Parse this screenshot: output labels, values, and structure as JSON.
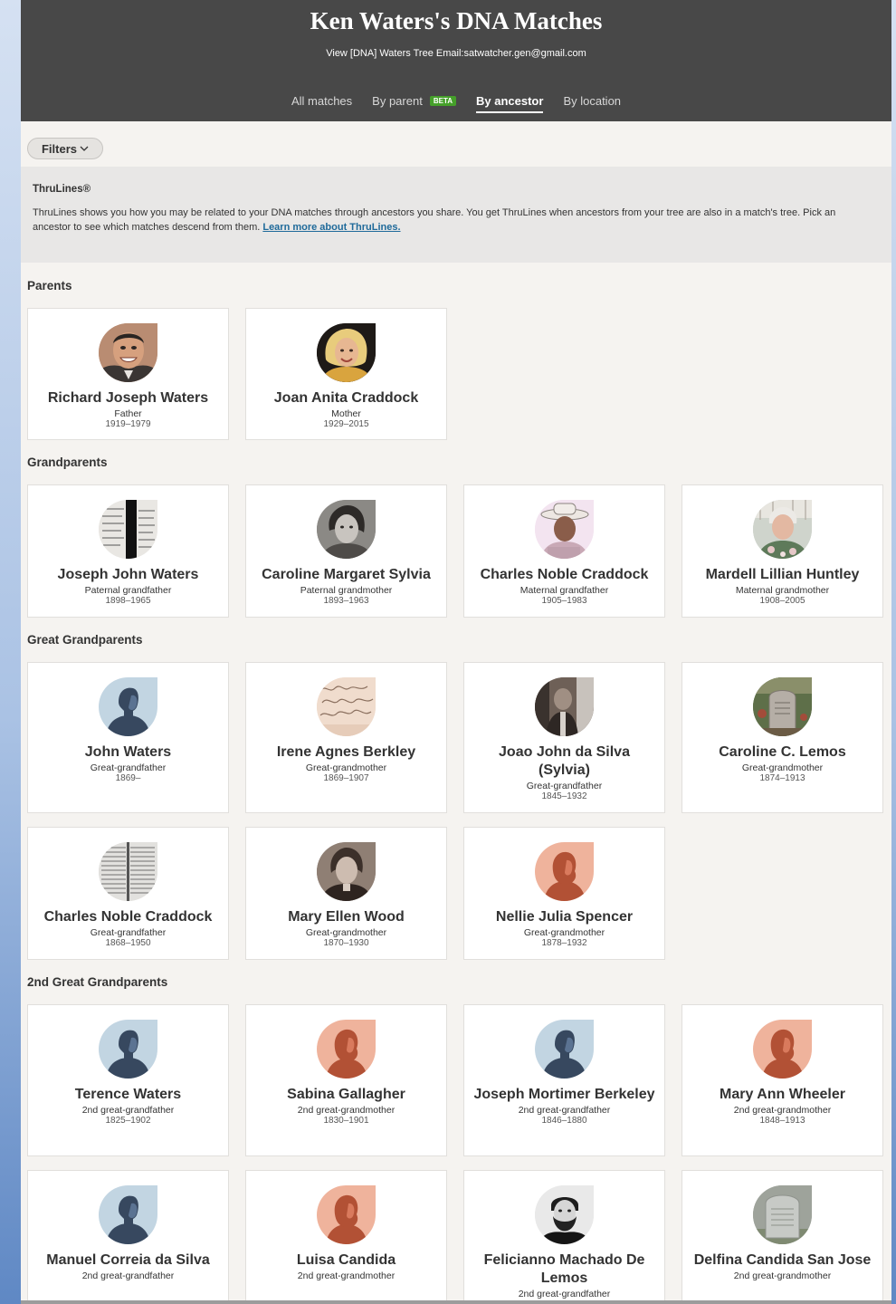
{
  "header": {
    "title": "Ken Waters's DNA Matches",
    "tree_link": "View [DNA] Waters Tree",
    "email_label": "Email:",
    "email": "satwatcher.gen@gmail.com"
  },
  "tabs": [
    {
      "label": "All matches",
      "active": false
    },
    {
      "label": "By parent",
      "badge": "BETA",
      "active": false
    },
    {
      "label": "By ancestor",
      "active": true
    },
    {
      "label": "By location",
      "active": false
    }
  ],
  "filters": {
    "label": "Filters"
  },
  "thrulines": {
    "title": "ThruLines®",
    "text": "ThruLines shows you how you may be related to your DNA matches through ancestors you share. You get ThruLines when ancestors from your tree are also in a match's tree. Pick an ancestor to see which matches descend from them. ",
    "link": "Learn more about ThruLines."
  },
  "sections": [
    {
      "title": "Parents",
      "cards": [
        {
          "name": "Richard Joseph Waters",
          "relation": "Father",
          "dates": "1919–1979",
          "photo": "man-smiling"
        },
        {
          "name": "Joan Anita Craddock",
          "relation": "Mother",
          "dates": "1929–2015",
          "photo": "woman-blonde"
        }
      ]
    },
    {
      "title": "Grandparents",
      "cards": [
        {
          "name": "Joseph John Waters",
          "relation": "Paternal grandfather",
          "dates": "1898–1965",
          "photo": "document"
        },
        {
          "name": "Caroline Margaret Sylvia",
          "relation": "Paternal grandmother",
          "dates": "1893–1963",
          "photo": "woman-dark"
        },
        {
          "name": "Charles Noble Craddock",
          "relation": "Maternal grandfather",
          "dates": "1905–1983",
          "photo": "man-hat"
        },
        {
          "name": "Mardell Lillian Huntley",
          "relation": "Maternal grandmother",
          "dates": "1908–2005",
          "photo": "woman-gray"
        }
      ]
    },
    {
      "title": "Great Grandparents",
      "cards": [
        {
          "name": "John Waters",
          "relation": "Great-grandfather",
          "dates": "1869–",
          "photo": "male-silhouette"
        },
        {
          "name": "Irene Agnes Berkley",
          "relation": "Great-grandmother",
          "dates": "1869–1907",
          "photo": "handwriting"
        },
        {
          "name": "Joao John da Silva (Sylvia)",
          "relation": "Great-grandfather",
          "dates": "1845–1932",
          "photo": "man-old"
        },
        {
          "name": "Caroline C. Lemos",
          "relation": "Great-grandmother",
          "dates": "1874–1913",
          "photo": "gravestone"
        },
        {
          "name": "Charles Noble Craddock",
          "relation": "Great-grandfather",
          "dates": "1868–1950",
          "photo": "ledger"
        },
        {
          "name": "Mary Ellen Wood",
          "relation": "Great-grandmother",
          "dates": "1870–1930",
          "photo": "woman-sepia"
        },
        {
          "name": "Nellie Julia Spencer",
          "relation": "Great-grandmother",
          "dates": "1878–1932",
          "photo": "female-silhouette"
        }
      ]
    },
    {
      "title": "2nd Great Grandparents",
      "cards": [
        {
          "name": "Terence Waters",
          "relation": "2nd great-grandfather",
          "dates": "1825–1902",
          "photo": "male-silhouette"
        },
        {
          "name": "Sabina Gallagher",
          "relation": "2nd great-grandmother",
          "dates": "1830–1901",
          "photo": "female-silhouette"
        },
        {
          "name": "Joseph Mortimer Berkeley",
          "relation": "2nd great-grandfather",
          "dates": "1846–1880",
          "photo": "male-silhouette"
        },
        {
          "name": "Mary Ann Wheeler",
          "relation": "2nd great-grandmother",
          "dates": "1848–1913",
          "photo": "female-silhouette"
        },
        {
          "name": "Manuel Correia da Silva",
          "relation": "2nd great-grandfather",
          "dates": "",
          "photo": "male-silhouette"
        },
        {
          "name": "Luisa Candida",
          "relation": "2nd great-grandmother",
          "dates": "",
          "photo": "female-silhouette"
        },
        {
          "name": "Felicianno Machado De Lemos",
          "relation": "2nd great-grandfather",
          "dates": "",
          "photo": "man-bearded"
        },
        {
          "name": "Delfina Candida San Jose",
          "relation": "2nd great-grandmother",
          "dates": "",
          "photo": "gravestone-gray"
        }
      ]
    }
  ]
}
